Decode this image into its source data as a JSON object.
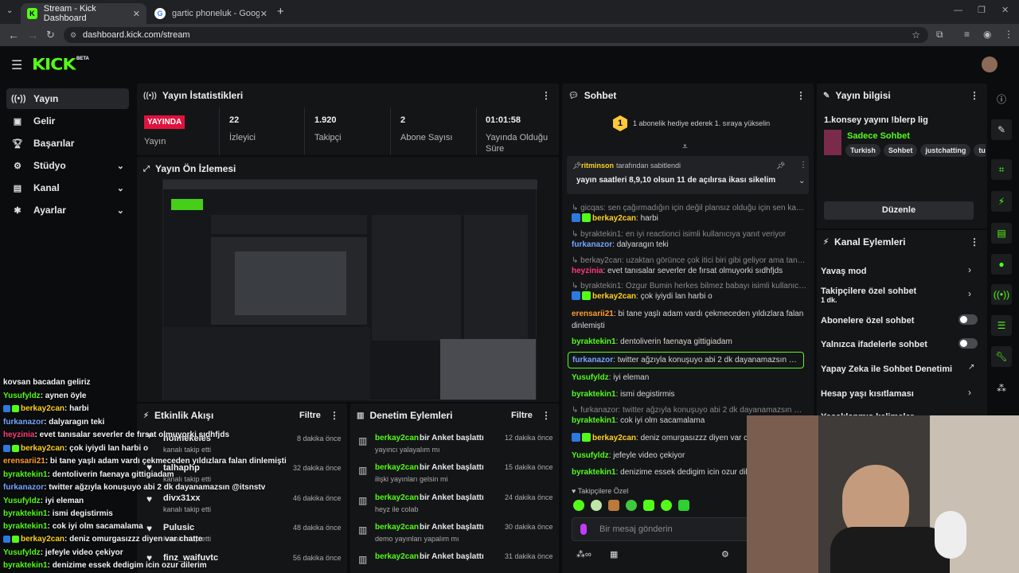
{
  "browser": {
    "tabs": [
      {
        "label": "Stream - Kick Dashboard"
      },
      {
        "label": "gartic phoneluk - Google Search"
      }
    ],
    "url": "dashboard.kick.com/stream"
  },
  "brand": {
    "logo": "KICK",
    "beta": "BETA",
    "accent": "#53fc18"
  },
  "sidebar": {
    "items": [
      {
        "label": "Yayın",
        "icon": "broadcast-icon"
      },
      {
        "label": "Gelir",
        "icon": "money-icon"
      },
      {
        "label": "Başarılar",
        "icon": "trophy-icon"
      },
      {
        "label": "Stüdyo",
        "icon": "studio-icon"
      },
      {
        "label": "Kanal",
        "icon": "channel-icon"
      },
      {
        "label": "Ayarlar",
        "icon": "gear-icon"
      }
    ]
  },
  "stats": {
    "title": "Yayın İstatistikleri",
    "live_badge": "YAYINDA",
    "live_label": "Yayın",
    "items": [
      {
        "value": "22",
        "label": "İzleyici"
      },
      {
        "value": "1.920",
        "label": "Takipçi"
      },
      {
        "value": "2",
        "label": "Abone Sayısı"
      },
      {
        "value": "01:01:58",
        "label": "Yayında Olduğu Süre"
      }
    ]
  },
  "preview": {
    "title": "Yayın Ön İzlemesi"
  },
  "activity": {
    "title": "Etkinlik Akışı",
    "filter": "Filtre",
    "items": [
      {
        "name": "hoimekeles",
        "sub": "kanalı takip etti",
        "time": "8 dakika önce"
      },
      {
        "name": "talhaphp",
        "sub": "kanalı takip etti",
        "time": "32 dakika önce"
      },
      {
        "name": "divx31xx",
        "sub": "kanalı takip etti",
        "time": "46 dakika önce"
      },
      {
        "name": "Pulusic",
        "sub": "kanalı takip etti",
        "time": "48 dakika önce"
      },
      {
        "name": "finz_waifuvtc",
        "sub": "",
        "time": "56 dakika önce"
      }
    ]
  },
  "moderation": {
    "title": "Denetim Eylemleri",
    "filter": "Filtre",
    "items": [
      {
        "user": "berkay2can",
        "action": "bir Anket başlattı",
        "sub": "yayıncı yalayalım mı",
        "time": "12 dakika önce"
      },
      {
        "user": "berkay2can",
        "action": "bir Anket başlattı",
        "sub": "ilişki yayınları gelsin mi",
        "time": "15 dakika önce"
      },
      {
        "user": "berkay2can",
        "action": "bir Anket başlattı",
        "sub": "heyz ile colab",
        "time": "24 dakika önce"
      },
      {
        "user": "berkay2can",
        "action": "bir Anket başlattı",
        "sub": "demo yayınları yapalım mı",
        "time": "30 dakika önce"
      },
      {
        "user": "berkay2can",
        "action": "bir Anket başlattı",
        "sub": "",
        "time": "31 dakika önce"
      }
    ]
  },
  "chat": {
    "title": "Sohbet",
    "promo": "1 abonelik hediye ederek 1. sıraya yükselin",
    "pinned_user": "ritminson",
    "pinned_by": "tarafından sabitlendi",
    "pinned_text": "yayın saatleri 8,9,10 olsun 11 de açılırsa ikası sikelim",
    "messages": [
      {
        "reply": "gicqas: sen çağırmadığın için değil plansız olduğu için sen kapıdan ko...",
        "user": "berkay2can",
        "text": "harbi",
        "color": "u-yellow"
      },
      {
        "reply": "byraktekin1: en iyi reactionci isimli kullanıcıya yanıt veriyor",
        "user": "furkanazor",
        "text": "dalyaragın teki",
        "color": "u-blue"
      },
      {
        "reply": "berkay2can: uzaktan görünce çok itici biri gibi geliyor ama tanıyınca iy...",
        "user": "heyzinia",
        "text": "evet tanısalar severler de fırsat olmuyorki sıdhfjds",
        "color": "u-pink"
      },
      {
        "reply": "byraktekin1: Ozgur Bumin herkes bilmez babayı isimli kullanıcıya yanıt ...",
        "user": "berkay2can",
        "text": "çok iyiydi lan harbi o",
        "color": "u-yellow"
      },
      {
        "reply": "",
        "user": "erensarii21",
        "text": "bi tane yaşlı adam vardı çekmeceden yıldızlara falan dinlemişti",
        "color": "u-orange"
      },
      {
        "reply": "",
        "user": "byraktekin1",
        "text": "dentoliverin faenaya gittigiadam",
        "color": "u-green"
      },
      {
        "reply": "",
        "user": "furkanazor",
        "text": "twitter ağzıyla konuşuyo abi 2 dk dayanamazsın @itsnstv",
        "color": "u-blue"
      },
      {
        "reply": "",
        "user": "Yusufyldz",
        "text": "iyi eleman",
        "color": "u-green"
      },
      {
        "reply": "",
        "user": "byraktekin1",
        "text": "ismi degistirmis",
        "color": "u-green"
      },
      {
        "reply": "furkanazor: twitter ağzıyla konuşuyo abi 2 dk dayanamazsın @itsnstv i...",
        "user": "byraktekin1",
        "text": "cok iyi olm sacamalama",
        "color": "u-green"
      },
      {
        "reply": "",
        "user": "berkay2can",
        "text": "deniz omurgasızzz diyen var cha",
        "color": "u-yellow"
      },
      {
        "reply": "",
        "user": "Yusufyldz",
        "text": "jefeyle video çekiyor",
        "color": "u-green"
      },
      {
        "reply": "",
        "user": "byraktekin1",
        "text": "denizime essek dedigim icin ozur dilerim",
        "color": "u-green"
      }
    ],
    "followers_only": "Takipçilere Özel",
    "input_placeholder": "Bir mesaj gönderin"
  },
  "stream_info": {
    "title": "Yayın bilgisi",
    "stream_title": "1.konsey yayını !blerp lig",
    "category": "Sadece Sohbet",
    "tags": [
      "Turkish",
      "Sohbet",
      "justchatting",
      "tu"
    ],
    "edit": "Düzenle"
  },
  "channel_actions": {
    "title": "Kanal Eylemleri",
    "items": [
      {
        "label": "Yavaş mod",
        "sub": "",
        "control": "chevron"
      },
      {
        "label": "Takipçilere özel sohbet",
        "sub": "1 dk.",
        "control": "chevron"
      },
      {
        "label": "Abonelere özel sohbet",
        "sub": "",
        "control": "toggle"
      },
      {
        "label": "Yalnızca ifadelerle sohbet",
        "sub": "",
        "control": "toggle"
      },
      {
        "label": "Yapay Zeka ile Sohbet Denetimi",
        "sub": "",
        "control": "external"
      },
      {
        "label": "Hesap yaşı kısıtlaması",
        "sub": "",
        "control": "chevron"
      },
      {
        "label": "Yasaklanmış kelimeler",
        "sub": "",
        "control": "chevron"
      }
    ]
  },
  "overlay_chat": [
    {
      "user": "",
      "text": "kovsan bacadan geliriz",
      "color": "#f4f4f4"
    },
    {
      "user": "Yusufyldz",
      "text": ": aynen öyle",
      "color": "#53fc18"
    },
    {
      "user": "berkay2can",
      "text": ": harbi",
      "color": "#ffd21e"
    },
    {
      "user": "furkanazor",
      "text": ": dalyaragın teki",
      "color": "#74a6ff"
    },
    {
      "user": "heyzinia",
      "text": ": evet tanısalar severler de fırsat olmuyorki sıdhfjds",
      "color": "#ff3b77"
    },
    {
      "user": "berkay2can",
      "text": ": çok iyiydi lan harbi o",
      "color": "#ffd21e"
    },
    {
      "user": "erensarii21",
      "text": ": bi tane yaşlı adam vardı çekmeceden yıldızlara falan dinlemişti",
      "color": "#ff9c2a"
    },
    {
      "user": "byraktekin1",
      "text": ": dentoliverin faenaya gittigiadam",
      "color": "#53fc18"
    },
    {
      "user": "furkanazor",
      "text": ": twitter ağzıyla konuşuyo abi 2 dk dayanamazsın @itsnstv",
      "color": "#74a6ff"
    },
    {
      "user": "Yusufyldz",
      "text": ": iyi eleman",
      "color": "#53fc18"
    },
    {
      "user": "byraktekin1",
      "text": ": ismi degistirmis",
      "color": "#53fc18"
    },
    {
      "user": "byraktekin1",
      "text": ": cok iyi olm sacamalama",
      "color": "#53fc18"
    },
    {
      "user": "berkay2can",
      "text": ": deniz omurgasızzz diyen var chatte",
      "color": "#ffd21e"
    },
    {
      "user": "Yusufyldz",
      "text": ": jefeyle video çekiyor",
      "color": "#53fc18"
    },
    {
      "user": "byraktekin1",
      "text": ": denizime essek dedigim icin ozur dilerim",
      "color": "#53fc18"
    }
  ]
}
